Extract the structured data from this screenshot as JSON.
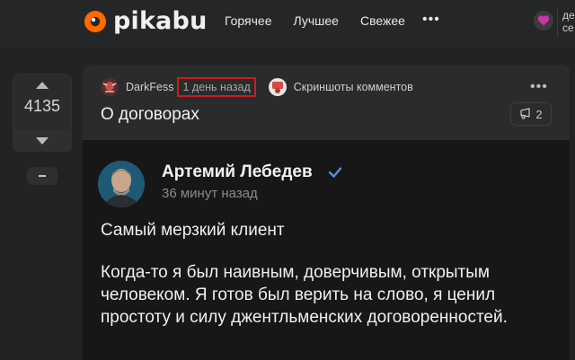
{
  "header": {
    "logo_text": "pikabu",
    "nav": [
      "Горячее",
      "Лучшее",
      "Свежее"
    ],
    "more_label": "•••",
    "right_text": "де\nсе",
    "brand_color": "#ff6a00",
    "heart_color": "#c936a7"
  },
  "vote": {
    "count": "4135",
    "up_icon": "arrow-up-icon",
    "down_icon": "arrow-down-icon"
  },
  "story": {
    "author": "DarkFess",
    "time": "1 день назад",
    "community": "Скриншоты комментов",
    "title": "О договорах",
    "more_label": "•••",
    "comments_count": "2",
    "highlight_color": "#d31a1a"
  },
  "post": {
    "name": "Артемий Лебедев",
    "time": "36 минут назад",
    "heading": "Самый мерзкий клиент",
    "body": "Когда-то я был наивным, доверчивым, открытым человеком. Я готов был верить на слово, я ценил простоту и силу джентльменских договоренностей.",
    "verified_color": "#5b8fdc"
  }
}
